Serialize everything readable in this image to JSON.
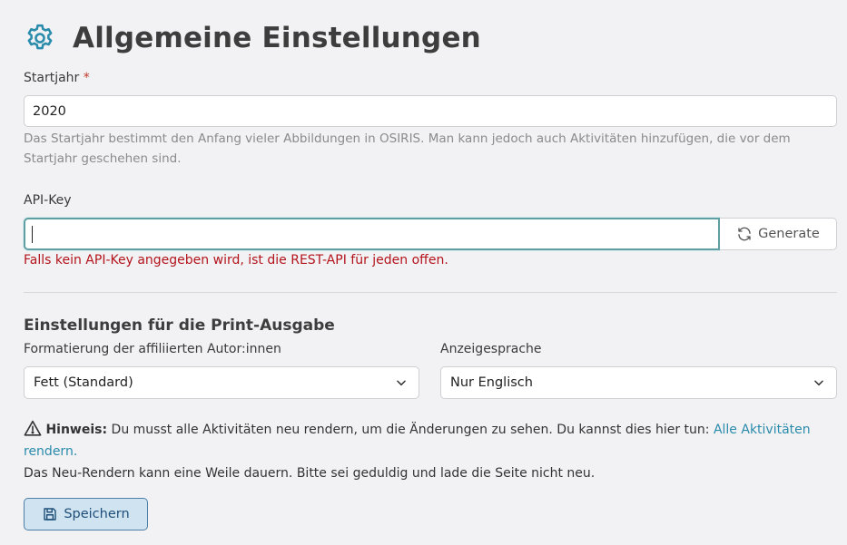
{
  "header": {
    "title": "Allgemeine Einstellungen",
    "icon": "gear-icon",
    "icon_color": "#2a8bab"
  },
  "startyear": {
    "label": "Startjahr",
    "required_marker": "*",
    "value": "2020",
    "help": "Das Startjahr bestimmt den Anfang vieler Abbildungen in OSIRIS. Man kann jedoch auch Aktivitäten hinzufügen, die vor dem Startjahr geschehen sind."
  },
  "apikey": {
    "label": "API-Key",
    "value": "",
    "generate_label": "Generate",
    "error": "Falls kein API-Key angegeben wird, ist die REST-API für jeden offen."
  },
  "print": {
    "section_title": "Einstellungen für die Print-Ausgabe",
    "affiliated_label": "Formatierung der affiliierten Autor:innen",
    "affiliated_value": "Fett (Standard)",
    "language_label": "Anzeigesprache",
    "language_value": "Nur Englisch"
  },
  "notice": {
    "title": "Hinweis:",
    "text": " Du musst alle Aktivitäten neu rendern, um die Änderungen zu sehen. Du kannst dies hier tun: ",
    "link": "Alle Aktivitäten rendern.",
    "line2": "Das Neu-Rendern kann eine Weile dauern. Bitte sei geduldig und lade die Seite nicht neu."
  },
  "save_button": {
    "label": "Speichern"
  },
  "colors": {
    "accent": "#2a8bab",
    "error": "#b3141c",
    "focus_border": "#5f9ea2",
    "save_bg": "#cfe3f1"
  }
}
